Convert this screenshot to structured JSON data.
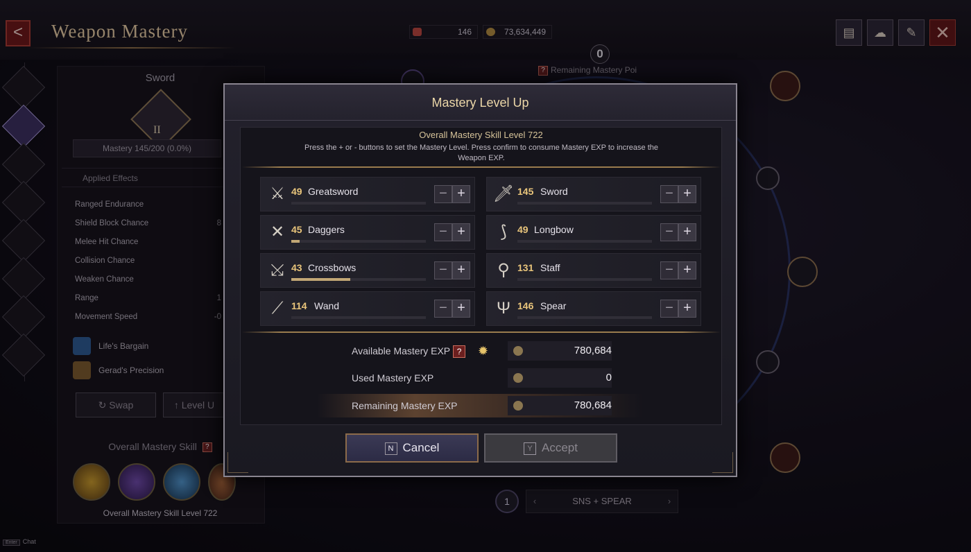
{
  "header": {
    "title": "Weapon Mastery",
    "back_icon": "back-arrow-icon"
  },
  "currency": [
    {
      "icon": "ticket-icon",
      "value": "146"
    },
    {
      "icon": "gold-coin-icon",
      "value": "73,634,449"
    }
  ],
  "top_icons": [
    "codex-icon",
    "fairy-icon",
    "scroll-icon",
    "close-icon"
  ],
  "left_panel": {
    "weapon_title": "Sword",
    "emblem_rank": "II",
    "mastery_text": "Mastery 145/200 (0.0%)",
    "applied_effects_label": "Applied Effects",
    "stats": [
      {
        "name": "Ranged Endurance",
        "value": ""
      },
      {
        "name": "Shield Block Chance",
        "value": "8"
      },
      {
        "name": "Melee Hit Chance",
        "value": ""
      },
      {
        "name": "Collision Chance",
        "value": ""
      },
      {
        "name": "Weaken Chance",
        "value": ""
      },
      {
        "name": "Range",
        "value": "1"
      },
      {
        "name": "Movement Speed",
        "value": "-0"
      }
    ],
    "bonuses": [
      "Life's Bargain",
      "Gerad's Precision"
    ],
    "swap_label": "Swap",
    "level_up_label": "Level U",
    "overall_skill_label": "Overall Mastery Skill",
    "overall_skill_level": "Overall Mastery Skill Level 722"
  },
  "arena": {
    "remaining_points_value": "0",
    "remaining_points_label": "Remaining Mastery Poi",
    "loadout_number": "1",
    "loadout_name": "SNS + SPEAR"
  },
  "chat": {
    "key": "Enter",
    "label": "Chat"
  },
  "modal": {
    "title": "Mastery Level Up",
    "overall_level": "Overall Mastery Skill Level 722",
    "help_text": "Press the + or - buttons to set the Mastery Level. Press confirm to consume Mastery EXP to increase the Weapon EXP.",
    "weapons": [
      {
        "level": "49",
        "name": "Greatsword",
        "progress": 0.0,
        "icon": "greatsword-icon",
        "glyph": "⚔"
      },
      {
        "level": "145",
        "name": "Sword",
        "progress": 0.0,
        "icon": "sword-icon",
        "glyph": "🗡"
      },
      {
        "level": "45",
        "name": "Daggers",
        "progress": 0.06,
        "icon": "daggers-icon",
        "glyph": "✕"
      },
      {
        "level": "49",
        "name": "Longbow",
        "progress": 0.0,
        "icon": "longbow-icon",
        "glyph": "⟆"
      },
      {
        "level": "43",
        "name": "Crossbows",
        "progress": 0.44,
        "icon": "crossbow-icon",
        "glyph": "⤩"
      },
      {
        "level": "131",
        "name": "Staff",
        "progress": 0.0,
        "icon": "staff-icon",
        "glyph": "⚲"
      },
      {
        "level": "114",
        "name": "Wand",
        "progress": 0.0,
        "icon": "wand-icon",
        "glyph": "⟋"
      },
      {
        "level": "146",
        "name": "Spear",
        "progress": 0.0,
        "icon": "spear-icon",
        "glyph": "Ψ"
      }
    ],
    "minus": "−",
    "plus": "+",
    "available_label": "Available Mastery EXP",
    "available_value": "780,684",
    "used_label": "Used Mastery EXP",
    "used_value": "0",
    "remaining_label": "Remaining Mastery EXP",
    "remaining_value": "780,684",
    "help_mark": "?",
    "cancel_key": "N",
    "cancel_label": "Cancel",
    "accept_key": "Y",
    "accept_label": "Accept"
  }
}
